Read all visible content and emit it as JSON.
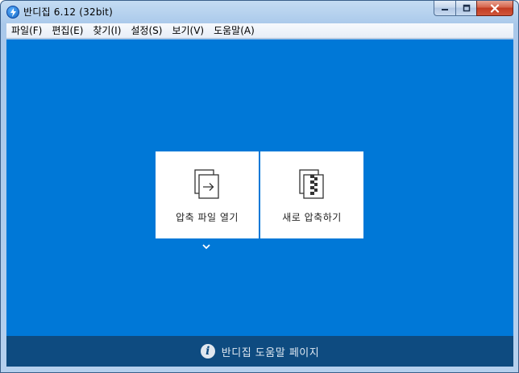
{
  "window": {
    "title": "반디집 6.12 (32bit)"
  },
  "menu": [
    {
      "label": "파일(F)"
    },
    {
      "label": "편집(E)"
    },
    {
      "label": "찾기(I)"
    },
    {
      "label": "설정(S)"
    },
    {
      "label": "보기(V)"
    },
    {
      "label": "도움말(A)"
    }
  ],
  "actions": {
    "open_label": "압축 파일 열기",
    "new_label": "새로 압축하기"
  },
  "footer": {
    "help_label": "반디집 도움말 페이지"
  },
  "colors": {
    "client_background": "#0078d7",
    "footer_background": "#0e4b80",
    "card_background": "#ffffff"
  }
}
